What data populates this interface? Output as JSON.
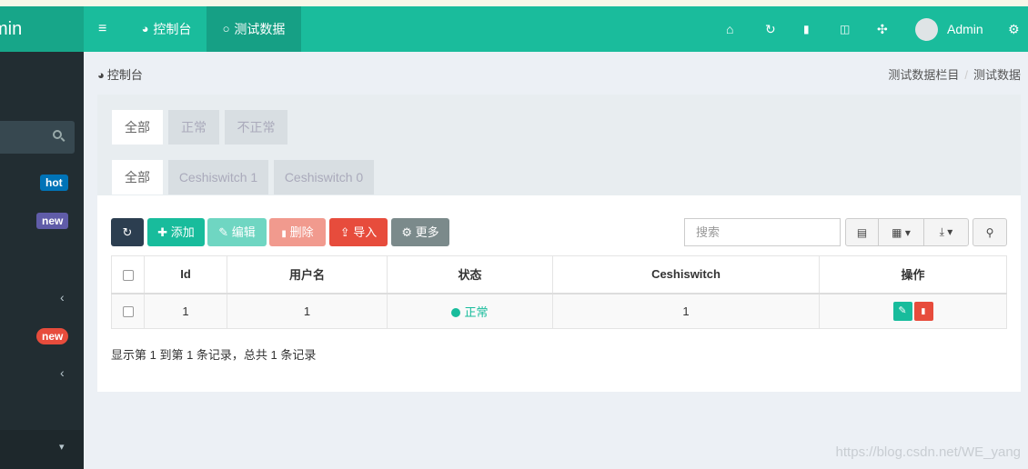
{
  "header": {
    "logo_text": "min",
    "menu_icon": "bars-icon",
    "tabs": [
      {
        "label": "控制台",
        "icon": "dashboard-icon"
      },
      {
        "label": "测试数据",
        "icon": "circle-o-icon"
      }
    ],
    "user": {
      "name": "Admin"
    },
    "right_icons": [
      "home-icon",
      "refresh-icon",
      "trash-icon",
      "translate-icon",
      "fullscreen-icon",
      "cogs-icon"
    ]
  },
  "sidebar": {
    "badges": [
      {
        "label": "hot",
        "color": "#0073b7"
      },
      {
        "label": "new",
        "color": "#605ca8"
      },
      {
        "label": "new",
        "color": "#e74c3c"
      }
    ]
  },
  "breadcrumb": {
    "left": "控制台",
    "right": [
      "测试数据栏目",
      "测试数据"
    ],
    "separator": "/"
  },
  "filters": {
    "row1": [
      {
        "label": "全部"
      },
      {
        "label": "正常"
      },
      {
        "label": "不正常"
      }
    ],
    "row2": [
      {
        "label": "全部"
      },
      {
        "label": "Ceshiswitch 1"
      },
      {
        "label": "Ceshiswitch 0"
      }
    ]
  },
  "toolbar": {
    "add_label": "添加",
    "edit_label": "编辑",
    "delete_label": "删除",
    "import_label": "导入",
    "more_label": "更多",
    "search_placeholder": "搜索",
    "colors": {
      "refresh": "#2c3e50",
      "add": "#18bc9c",
      "edit": "#6fd6c2",
      "delete": "#f19a8e",
      "import": "#e74c3c",
      "more": "#7b8a8b"
    }
  },
  "table": {
    "columns": [
      "Id",
      "用户名",
      "状态",
      "Ceshiswitch",
      "操作"
    ],
    "rows": [
      {
        "id": "1",
        "username": "1",
        "status": "正常",
        "ceshiswitch": "1"
      }
    ]
  },
  "summary": "显示第 1 到第 1 条记录，总共 1 条记录",
  "watermark": "https://blog.csdn.net/WE_yang"
}
